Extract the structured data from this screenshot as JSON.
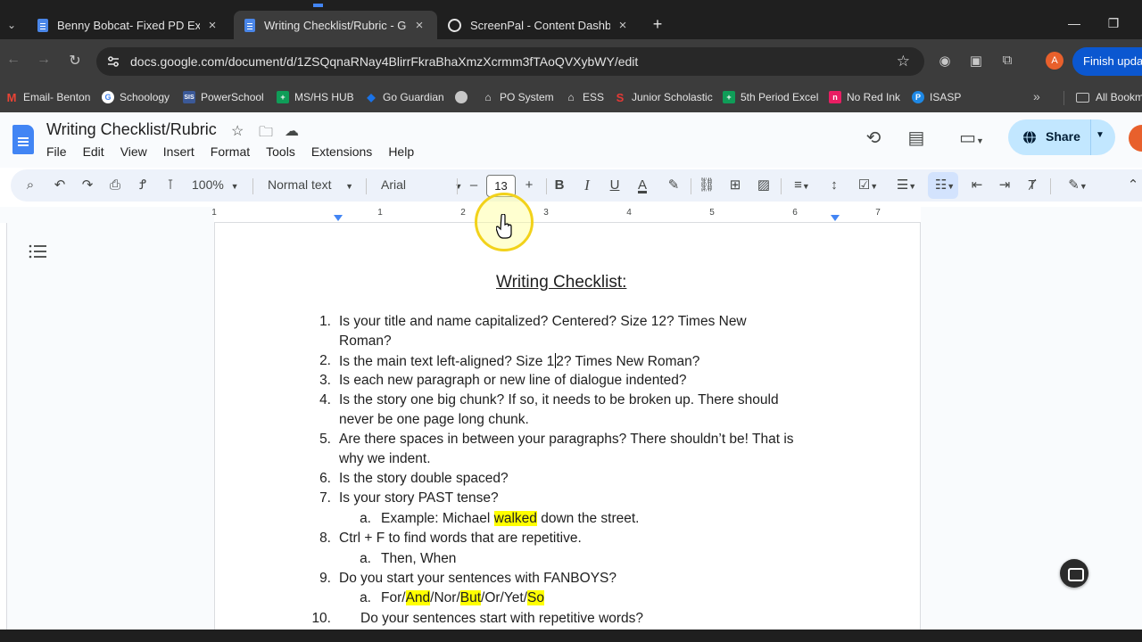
{
  "browser": {
    "tabs": [
      {
        "title": "Benny Bobcat- Fixed PD Examp",
        "icon": "google-docs-icon",
        "active": false
      },
      {
        "title": "Writing Checklist/Rubric - Goog",
        "icon": "google-docs-icon",
        "active": true
      },
      {
        "title": "ScreenPal - Content Dashboard",
        "icon": "screenpal-icon",
        "active": false
      }
    ],
    "close_glyph": "×",
    "new_tab_glyph": "+",
    "url": "docs.google.com/document/d/1ZSQqnaRNay4BlirrFkraBhaXmzXcrmm3fTAoQVXybWY/edit",
    "profile_initial": "A",
    "finish_update_label": "Finish update",
    "bookmarks": [
      {
        "label": "Email- Benton",
        "icon": "gmail-icon",
        "color": "#ea4335"
      },
      {
        "label": "Schoology",
        "icon": "google-icon",
        "color": "#ffffff"
      },
      {
        "label": "PowerSchool",
        "icon": "sis-icon",
        "color": "#3b5998"
      },
      {
        "label": "MS/HS HUB",
        "icon": "sheets-icon",
        "color": "#0f9d58"
      },
      {
        "label": "Go Guardian",
        "icon": "shield-icon",
        "color": "#1a73e8"
      },
      {
        "label": "",
        "icon": "globe-icon",
        "color": "#9aa0a6"
      },
      {
        "label": "PO System",
        "icon": "bank-icon",
        "color": "#9aa0a6"
      },
      {
        "label": "ESS",
        "icon": "bank-icon",
        "color": "#9aa0a6"
      },
      {
        "label": "Junior Scholastic",
        "icon": "scholastic-icon",
        "color": "#e53935"
      },
      {
        "label": "5th Period Excel",
        "icon": "sheets-icon",
        "color": "#0f9d58"
      },
      {
        "label": "No Red Ink",
        "icon": "noredink-icon",
        "color": "#e91e63"
      },
      {
        "label": "ISASP",
        "icon": "pearson-icon",
        "color": "#1e88e5"
      }
    ],
    "all_bookmarks_label": "All Bookmarks"
  },
  "docs": {
    "title": "Writing Checklist/Rubric",
    "menus": [
      "File",
      "Edit",
      "View",
      "Insert",
      "Format",
      "Tools",
      "Extensions",
      "Help"
    ],
    "share_label": "Share",
    "toolbar": {
      "zoom": "100%",
      "style": "Normal text",
      "font": "Arial",
      "font_size": "13",
      "minus": "–",
      "plus": "+",
      "bold": "B",
      "italic": "I",
      "underline": "U",
      "text_color": "A"
    },
    "ruler_numbers": [
      "1",
      "1",
      "2",
      "3",
      "4",
      "5",
      "6",
      "7"
    ]
  },
  "document": {
    "heading": "Writing Checklist:",
    "items": [
      {
        "num": "1.",
        "lines": [
          "Is your title and name capitalized? Centered? Size 12? Times New",
          "Roman?"
        ]
      },
      {
        "num": "2.",
        "before": "Is the main text left-aligned? Size 1",
        "after": "2? Times New Roman?"
      },
      {
        "num": "3.",
        "lines": [
          "Is each new paragraph or new line of dialogue indented?"
        ]
      },
      {
        "num": "4.",
        "lines": [
          "Is the story one big chunk? If so, it needs to be broken up. There should",
          "never be one page long chunk."
        ]
      },
      {
        "num": "5.",
        "lines": [
          "Are there spaces in between your paragraphs? There shouldn’t be! That is",
          "why we indent."
        ]
      },
      {
        "num": "6.",
        "lines": [
          "Is the story double spaced?"
        ]
      },
      {
        "num": "7.",
        "lines": [
          "Is your story PAST tense?"
        ]
      },
      {
        "num": "a.",
        "before": "Example: Michael ",
        "highlight": "walked",
        "after": " down the street."
      },
      {
        "num": "8.",
        "lines": [
          "Ctrl + F to find words that are repetitive."
        ]
      },
      {
        "num": "a.",
        "lines": [
          "Then, When"
        ]
      },
      {
        "num": "9.",
        "lines": [
          "Do you start your sentences with FANBOYS?"
        ]
      },
      {
        "num": "a.",
        "fanboys": [
          "For/",
          "And",
          "/Nor/",
          "But",
          "/Or/Yet/",
          "So"
        ]
      },
      {
        "num": "10.",
        "lines": [
          "Do your sentences start with repetitive words?"
        ]
      }
    ],
    "highlight_color": "#ffff00"
  }
}
